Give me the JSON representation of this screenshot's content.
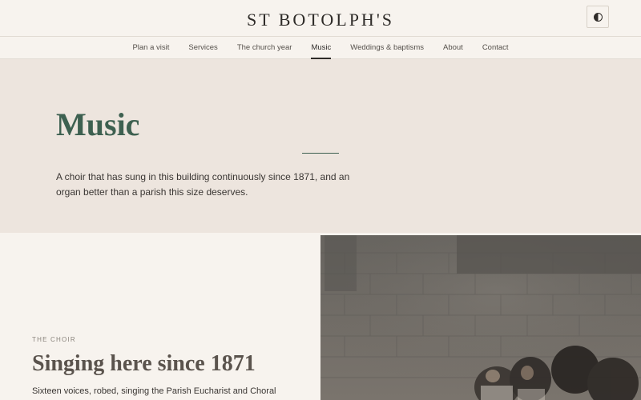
{
  "header": {
    "site_title": "ST BOTOLPH'S"
  },
  "theme_toggle": {
    "icon": "half-circle-icon"
  },
  "nav": {
    "items": [
      {
        "label": "Plan a visit"
      },
      {
        "label": "Services"
      },
      {
        "label": "The church year"
      },
      {
        "label": "Music",
        "active": true
      },
      {
        "label": "Weddings & baptisms"
      },
      {
        "label": "About"
      },
      {
        "label": "Contact"
      }
    ]
  },
  "hero": {
    "title": "Music",
    "intro": "A choir that has sung in this building continuously since 1871, and an organ better than a parish this size deserves."
  },
  "choir": {
    "eyebrow": "THE CHOIR",
    "title": "Singing here since 1871",
    "text": "Sixteen voices, robed, singing the Parish Eucharist and Choral"
  },
  "colors": {
    "accent": "#3d6050",
    "hero_bg": "#ede5de",
    "page_bg": "#f7f3ee"
  }
}
